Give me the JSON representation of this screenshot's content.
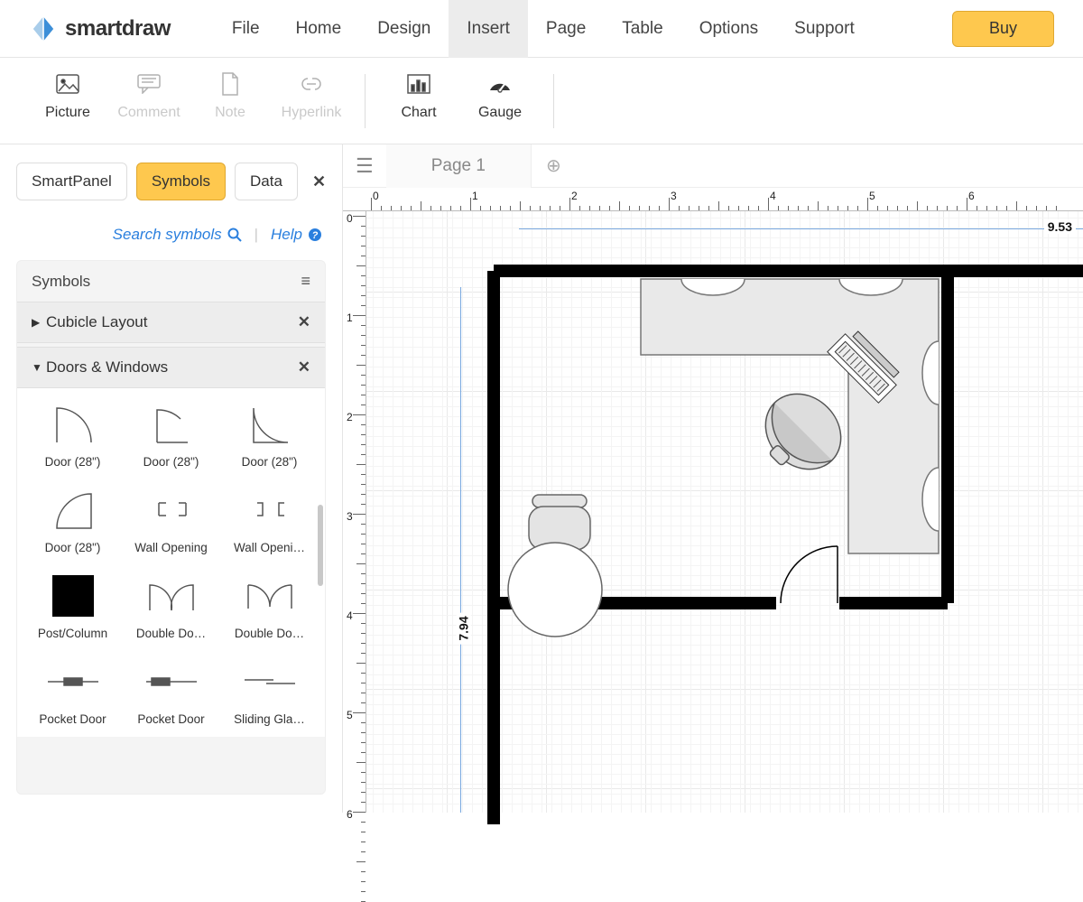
{
  "brand": "smartdraw",
  "menu": {
    "items": [
      "File",
      "Home",
      "Design",
      "Insert",
      "Page",
      "Table",
      "Options",
      "Support"
    ],
    "active": "Insert",
    "buy": "Buy"
  },
  "ribbon": [
    {
      "id": "picture",
      "label": "Picture",
      "enabled": true
    },
    {
      "id": "comment",
      "label": "Comment",
      "enabled": false
    },
    {
      "id": "note",
      "label": "Note",
      "enabled": false
    },
    {
      "id": "hyperlink",
      "label": "Hyperlink",
      "enabled": false
    },
    {
      "id": "chart",
      "label": "Chart",
      "enabled": true
    },
    {
      "id": "gauge",
      "label": "Gauge",
      "enabled": true
    }
  ],
  "panel": {
    "tabs": [
      "SmartPanel",
      "Symbols",
      "Data"
    ],
    "active": "Symbols",
    "search": "Search symbols",
    "help": "Help",
    "title": "Symbols",
    "groups": [
      {
        "name": "Cubicle Layout",
        "expanded": false
      },
      {
        "name": "Doors & Windows",
        "expanded": true
      }
    ],
    "symbols": [
      "Door (28\")",
      "Door (28\")",
      "Door (28\")",
      "Door (28\")",
      "Wall Opening",
      "Wall Openi…",
      "Post/Column",
      "Double Do…",
      "Double Do…",
      "Pocket Door",
      "Pocket Door",
      "Sliding Gla…"
    ]
  },
  "page": {
    "current": "Page 1"
  },
  "ruler": {
    "h": [
      "0",
      "1",
      "2",
      "3",
      "4",
      "5",
      "6"
    ],
    "v": [
      "0",
      "1",
      "2",
      "3",
      "4",
      "5",
      "6"
    ]
  },
  "dims": {
    "width": "9.53",
    "height": "7.94"
  }
}
